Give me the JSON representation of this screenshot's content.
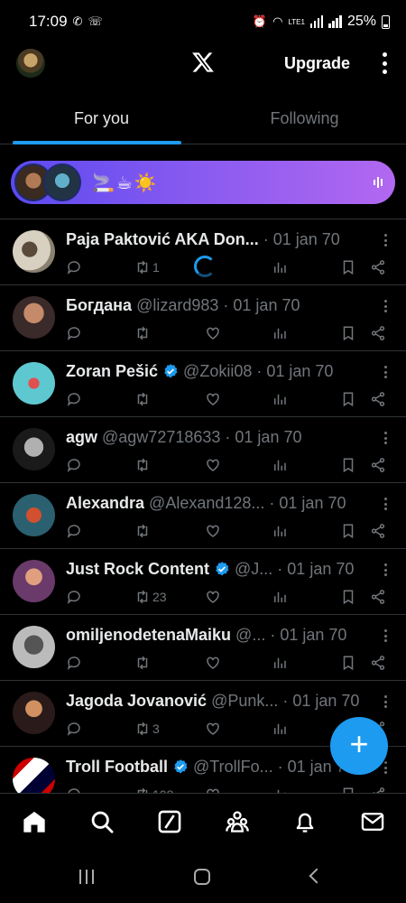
{
  "status_bar": {
    "time": "17:09",
    "battery": "25%",
    "network": "LTE1"
  },
  "header": {
    "upgrade_label": "Upgrade",
    "logo": "x-logo-icon"
  },
  "tabs": [
    {
      "label": "For you",
      "active": true
    },
    {
      "label": "Following",
      "active": false
    }
  ],
  "spaces_bar": {
    "emoji": "🚬☕☀️"
  },
  "tweets": [
    {
      "name": "Paja Paktović AKA Don...",
      "handle": "",
      "verified": false,
      "date": "01 jan 70",
      "retweets": "1",
      "loading": true
    },
    {
      "name": "Богдана",
      "handle": "@lizard983",
      "verified": false,
      "date": "01 jan 70",
      "retweets": ""
    },
    {
      "name": "Zoran Pešić",
      "handle": "@Zokii08",
      "verified": true,
      "date": "01 jan 70",
      "retweets": ""
    },
    {
      "name": "agw",
      "handle": "@agw72718633",
      "verified": false,
      "date": "01 jan 70",
      "retweets": ""
    },
    {
      "name": "Alexandra",
      "handle": "@Alexand128...",
      "verified": false,
      "date": "01 jan 70",
      "retweets": ""
    },
    {
      "name": "Just Rock Content",
      "handle": "@J...",
      "verified": true,
      "date": "01 jan 70",
      "retweets": "23"
    },
    {
      "name": "omiljenodetenaMaiku",
      "handle": "@...",
      "verified": false,
      "date": "01 jan 70",
      "retweets": ""
    },
    {
      "name": "Jagoda Jovanović",
      "handle": "@Punk...",
      "verified": false,
      "date": "01 jan 70",
      "retweets": "3"
    },
    {
      "name": "Troll Football",
      "handle": "@TrollFo...",
      "verified": true,
      "date": "01 jan 70",
      "retweets": "108"
    }
  ],
  "colors": {
    "accent": "#1d9bf0",
    "background": "#000000",
    "muted": "#71767b",
    "divider": "#2f3336"
  },
  "bottom_nav": [
    "home-icon",
    "search-icon",
    "grok-icon",
    "communities-icon",
    "notifications-icon",
    "messages-icon"
  ],
  "fab": {
    "label": "+"
  }
}
